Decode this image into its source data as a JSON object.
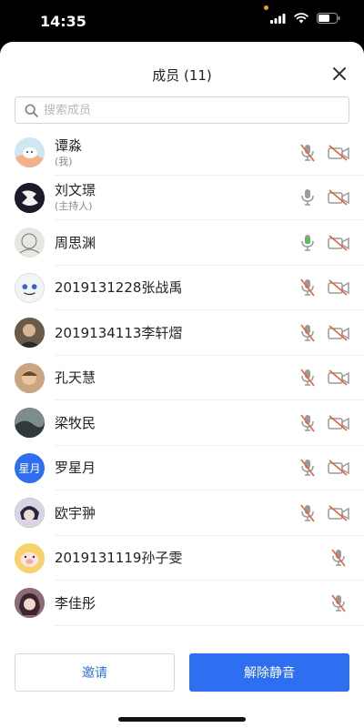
{
  "status_bar": {
    "time": "14:35"
  },
  "header": {
    "title": "成员 (11)"
  },
  "search": {
    "placeholder": "搜索成员"
  },
  "members": [
    {
      "name": "谭淼",
      "subtitle": "(我)",
      "mic": "muted",
      "video": "off"
    },
    {
      "name": "刘文璟",
      "subtitle": "(主持人)",
      "mic": "on",
      "video": "off"
    },
    {
      "name": "周思渊",
      "subtitle": "",
      "mic": "speaking",
      "video": "off"
    },
    {
      "name": "2019131228张战禹",
      "subtitle": "",
      "mic": "muted",
      "video": "off"
    },
    {
      "name": "2019134113李轩熠",
      "subtitle": "",
      "mic": "muted",
      "video": "off"
    },
    {
      "name": "孔天慧",
      "subtitle": "",
      "mic": "muted",
      "video": "off"
    },
    {
      "name": "梁牧民",
      "subtitle": "",
      "mic": "muted",
      "video": "off"
    },
    {
      "name": "罗星月",
      "subtitle": "",
      "avatar_text": "星月",
      "mic": "muted",
      "video": "off"
    },
    {
      "name": "欧宇翀",
      "subtitle": "",
      "mic": "muted",
      "video": "off"
    },
    {
      "name": "2019131119孙子雯",
      "subtitle": "",
      "mic": "muted",
      "video": "none"
    },
    {
      "name": "李佳彤",
      "subtitle": "",
      "mic": "muted",
      "video": "none"
    }
  ],
  "footer": {
    "invite_label": "邀请",
    "unmute_all_label": "解除静音"
  },
  "colors": {
    "accent": "#2d6ff0",
    "mute_slash": "#e8603c",
    "speaking": "#4cc84a"
  }
}
